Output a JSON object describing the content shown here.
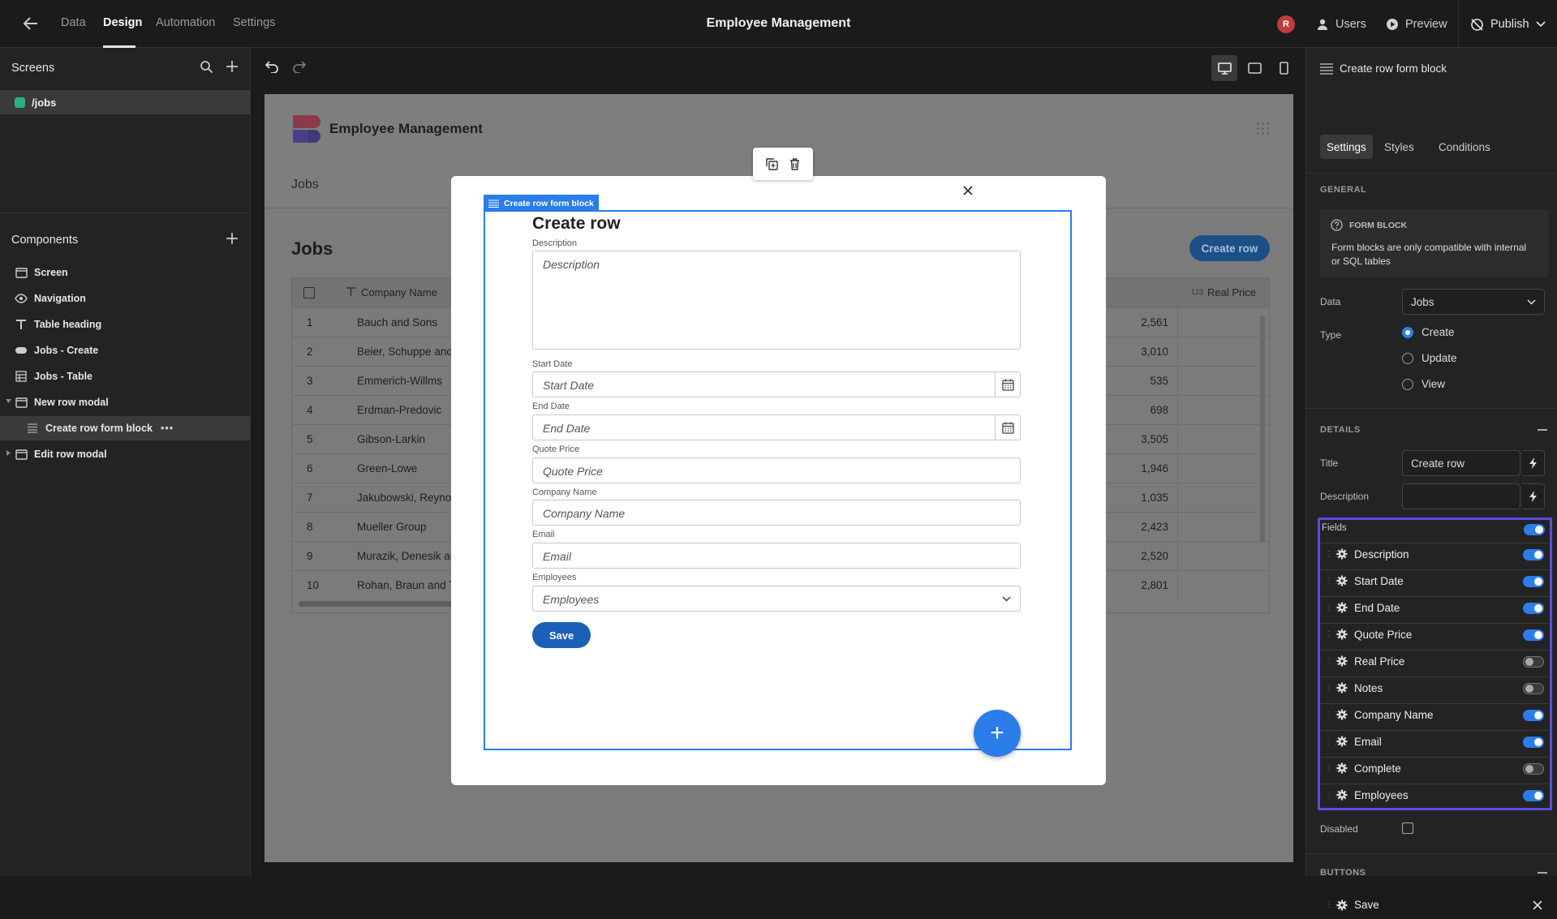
{
  "topbar": {
    "nav": [
      "Data",
      "Design",
      "Automation",
      "Settings"
    ],
    "title": "Employee Management",
    "avatar_initial": "R",
    "users_label": "Users",
    "preview_label": "Preview",
    "publish_label": "Publish"
  },
  "left": {
    "screens_title": "Screens",
    "route": "/jobs",
    "components_title": "Components",
    "components": [
      "Screen",
      "Navigation",
      "Table heading",
      "Jobs - Create",
      "Jobs - Table",
      "New row modal",
      "Create row form block",
      "Edit row modal"
    ]
  },
  "app": {
    "name": "Employee Management",
    "nav_item": "Jobs",
    "heading": "Jobs",
    "create_button": "Create row",
    "table": {
      "col_company": "Company Name",
      "col_real_price_type": "123",
      "col_real_price": "Real Price",
      "rows": [
        {
          "n": "1",
          "company": "Bauch and Sons",
          "price": "2,561"
        },
        {
          "n": "2",
          "company": "Beier, Schuppe and I",
          "price": "3,010"
        },
        {
          "n": "3",
          "company": "Emmerich-Willms",
          "price": "535"
        },
        {
          "n": "4",
          "company": "Erdman-Predovic",
          "price": "698"
        },
        {
          "n": "5",
          "company": "Gibson-Larkin",
          "price": "3,505"
        },
        {
          "n": "6",
          "company": "Green-Lowe",
          "price": "1,946"
        },
        {
          "n": "7",
          "company": "Jakubowski, Reynolc",
          "price": "1,035"
        },
        {
          "n": "8",
          "company": "Mueller Group",
          "price": "2,423"
        },
        {
          "n": "9",
          "company": "Murazik, Denesik anc",
          "price": "2,520"
        },
        {
          "n": "10",
          "company": "Rohan, Braun and Te",
          "price": "2,801"
        }
      ]
    }
  },
  "modal": {
    "tag": "Create row form block",
    "title": "Create row",
    "fields": [
      {
        "label": "Description",
        "placeholder": "Description"
      },
      {
        "label": "Start Date",
        "placeholder": "Start Date"
      },
      {
        "label": "End Date",
        "placeholder": "End Date"
      },
      {
        "label": "Quote Price",
        "placeholder": "Quote Price"
      },
      {
        "label": "Company Name",
        "placeholder": "Company Name"
      },
      {
        "label": "Email",
        "placeholder": "Email"
      },
      {
        "label": "Employees",
        "placeholder": "Employees"
      }
    ],
    "save": "Save"
  },
  "right": {
    "title": "Create row form block",
    "tabs": [
      "Settings",
      "Styles",
      "Conditions"
    ],
    "general": "GENERAL",
    "info_title": "FORM BLOCK",
    "info_text": "Form blocks are only compatible with internal or SQL tables",
    "data_label": "Data",
    "data_value": "Jobs",
    "type_label": "Type",
    "types": [
      "Create",
      "Update",
      "View"
    ],
    "type_selected": "Create",
    "details": "DETAILS",
    "title_label": "Title",
    "title_value": "Create row",
    "description_label": "Description",
    "fields_label": "Fields",
    "fields": [
      {
        "name": "Description",
        "on": true
      },
      {
        "name": "Start Date",
        "on": true
      },
      {
        "name": "End Date",
        "on": true
      },
      {
        "name": "Quote Price",
        "on": true
      },
      {
        "name": "Real Price",
        "on": false
      },
      {
        "name": "Notes",
        "on": false
      },
      {
        "name": "Company Name",
        "on": true
      },
      {
        "name": "Email",
        "on": true
      },
      {
        "name": "Complete",
        "on": false
      },
      {
        "name": "Employees",
        "on": true
      }
    ],
    "disabled_label": "Disabled",
    "buttons": "BUTTONS",
    "button_item": "Save"
  },
  "colors": {
    "accent": "#2b7de9",
    "highlight": "#5b4ce0",
    "route_dot": "#2bb07f"
  }
}
